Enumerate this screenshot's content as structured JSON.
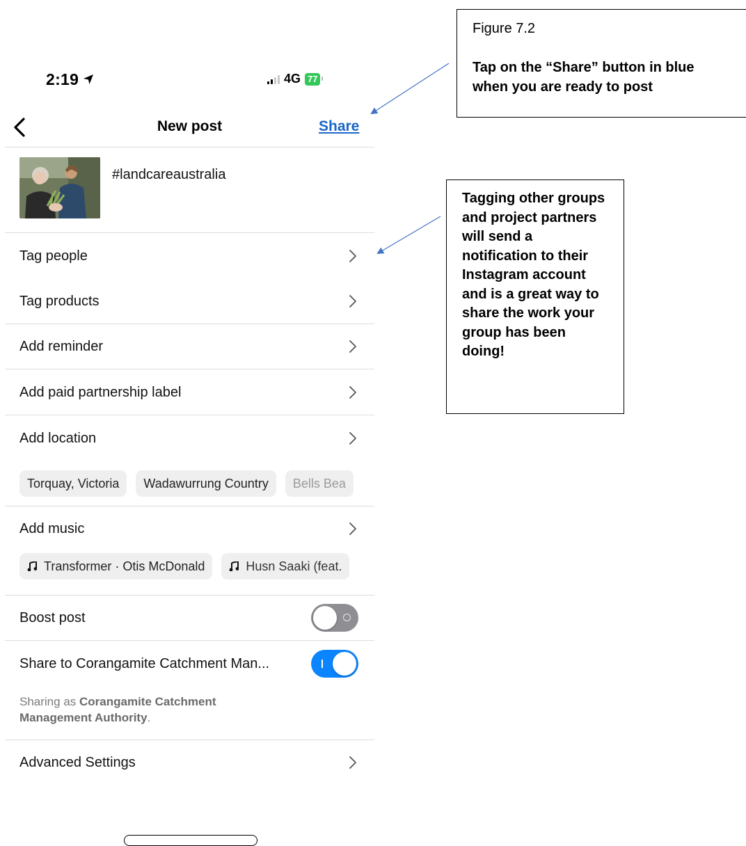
{
  "status_bar": {
    "time": "2:19",
    "network": "4G",
    "battery": "77"
  },
  "header": {
    "title": "New post",
    "share_label": "Share"
  },
  "caption": {
    "text": "#landcareaustralia"
  },
  "rows": {
    "tag_people": "Tag people",
    "tag_products": "Tag products",
    "add_reminder": "Add reminder",
    "paid_partnership": "Add paid partnership label",
    "add_location": "Add location",
    "add_music": "Add music",
    "boost_post": "Boost post",
    "share_to": "Share to Corangamite Catchment Man...",
    "advanced_settings": "Advanced Settings"
  },
  "location_suggestions": [
    "Torquay, Victoria",
    "Wadawurrung Country",
    "Bells Bea"
  ],
  "music_suggestions": [
    "Transformer · Otis McDonald",
    "Husn Saaki (feat."
  ],
  "toggles": {
    "boost_post": false,
    "share_to": true
  },
  "sharing_as": {
    "prefix": "Sharing as",
    "account": "Corangamite Catchment Management Authority",
    "suffix": "."
  },
  "annotations": {
    "figure_label": "Figure 7.2",
    "figure_text": "Tap on the “Share” button in blue when you are ready to post",
    "tagging_text": "Tagging other groups and project partners will send a notification to their Instagram account and is a great way to share the work your group has been doing!"
  },
  "colors": {
    "share_blue": "#1a66c8",
    "toggle_on": "#0a84ff",
    "toggle_off": "#8e8e93",
    "battery_green": "#34c759",
    "annotation_arrow": "#4472c4"
  }
}
